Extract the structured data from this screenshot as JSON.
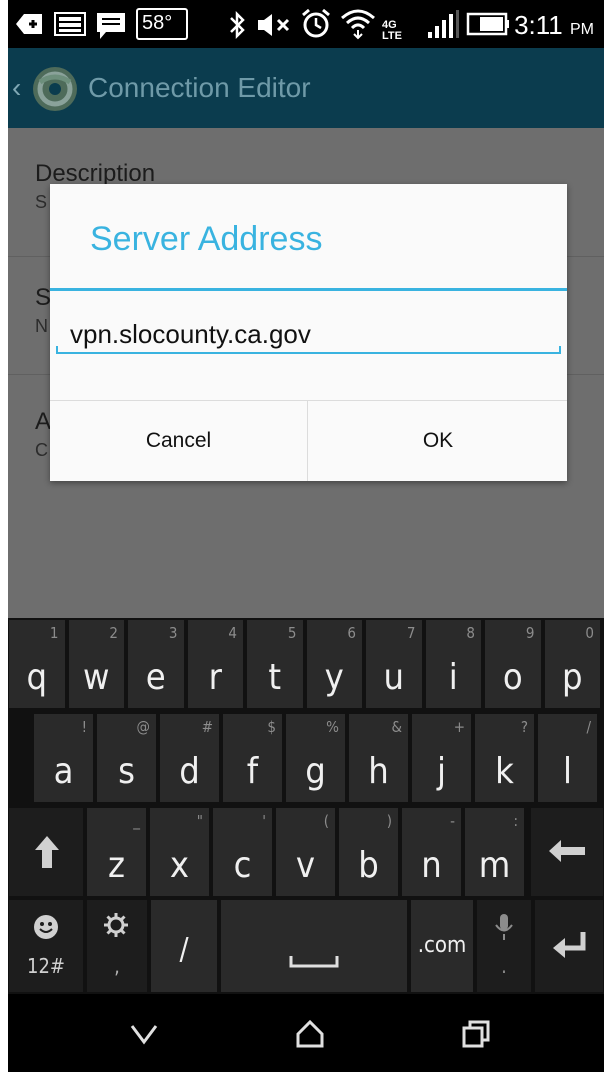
{
  "status_bar": {
    "temperature": "58°",
    "network": "4G LTE",
    "time": "3:11",
    "ampm": "PM"
  },
  "app_bar": {
    "title": "Connection Editor"
  },
  "background_settings": [
    {
      "label": "Description",
      "value": "S"
    },
    {
      "label": "S",
      "value": "N"
    },
    {
      "label": "A",
      "value": "C"
    }
  ],
  "dialog": {
    "title": "Server Address",
    "input_value": "vpn.slocounty.ca.gov",
    "cancel_label": "Cancel",
    "ok_label": "OK"
  },
  "keyboard": {
    "row1": [
      {
        "key": "q",
        "hint": "1"
      },
      {
        "key": "w",
        "hint": "2"
      },
      {
        "key": "e",
        "hint": "3"
      },
      {
        "key": "r",
        "hint": "4"
      },
      {
        "key": "t",
        "hint": "5"
      },
      {
        "key": "y",
        "hint": "6"
      },
      {
        "key": "u",
        "hint": "7"
      },
      {
        "key": "i",
        "hint": "8"
      },
      {
        "key": "o",
        "hint": "9"
      },
      {
        "key": "p",
        "hint": "0"
      }
    ],
    "row2": [
      {
        "key": "a",
        "hint": "!"
      },
      {
        "key": "s",
        "hint": "@"
      },
      {
        "key": "d",
        "hint": "#"
      },
      {
        "key": "f",
        "hint": "$"
      },
      {
        "key": "g",
        "hint": "%"
      },
      {
        "key": "h",
        "hint": "&"
      },
      {
        "key": "j",
        "hint": "+"
      },
      {
        "key": "k",
        "hint": "?"
      },
      {
        "key": "l",
        "hint": "/"
      }
    ],
    "row3": [
      {
        "key": "z",
        "hint": "_"
      },
      {
        "key": "x",
        "hint": "\""
      },
      {
        "key": "c",
        "hint": "'"
      },
      {
        "key": "v",
        "hint": "("
      },
      {
        "key": "b",
        "hint": ")"
      },
      {
        "key": "n",
        "hint": "-"
      },
      {
        "key": "m",
        "hint": ":"
      }
    ],
    "symbols_label": "12#",
    "settings_hint": ",",
    "slash_label": "/",
    "dotcom_label": ".com",
    "mic_hint": "."
  },
  "colors": {
    "accent": "#39b3e0",
    "app_bar": "#0b3c4e",
    "dim_background": "#6e6e6e",
    "key": "#2a2a2a"
  }
}
